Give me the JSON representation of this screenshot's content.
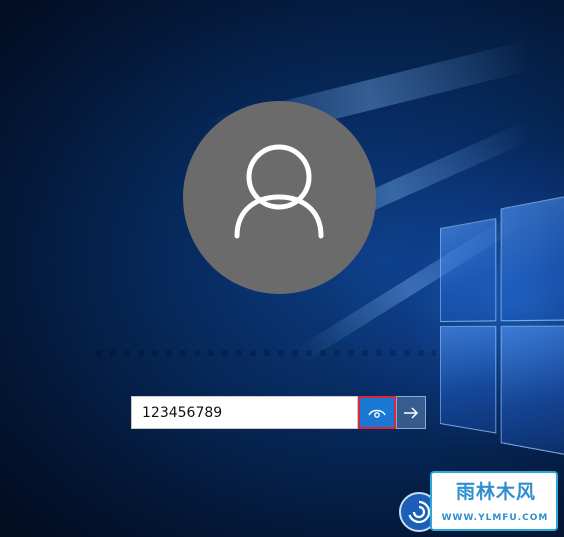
{
  "login": {
    "password_value": "123456789",
    "reveal_icon": "eye-icon",
    "submit_icon": "arrow-right-icon",
    "ease_of_access_icon": "ease-of-access-icon",
    "avatar_icon": "user-silhouette-icon"
  },
  "watermark": {
    "title": "雨林木风",
    "url": "WWW.YLMFU.COM"
  },
  "colors": {
    "avatar_bg": "#6b6b6b",
    "reveal_button": "#1a78d4",
    "highlight_border": "#d9283b",
    "background": "#072a5e"
  }
}
